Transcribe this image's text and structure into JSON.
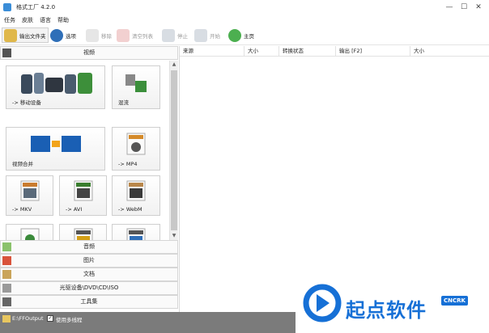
{
  "window": {
    "title": "格式工厂 4.2.0",
    "minimize": "—",
    "maximize": "☐",
    "close": "✕"
  },
  "menu": {
    "items": [
      "任务",
      "皮肤",
      "语言",
      "帮助"
    ]
  },
  "toolbar": {
    "output_folder": "输出文件夹",
    "options": "选项",
    "remove": "移除",
    "clear_list": "清空列表",
    "stop": "停止",
    "start": "开始",
    "home": "主页"
  },
  "left": {
    "video_header": "视频",
    "tiles": {
      "mobile": "-> 移动设备",
      "mux": "混流",
      "join": "视频合并",
      "mp4": "-> MP4",
      "mkv": "-> MKV",
      "avi": "-> AVI",
      "webm": "-> WebM"
    },
    "categories": [
      "音频",
      "图片",
      "文档",
      "光驱设备\\DVD\\CD\\ISO",
      "工具集"
    ]
  },
  "right": {
    "columns": [
      "来源",
      "大小",
      "转换状态",
      "输出 [F2]",
      "大小"
    ]
  },
  "status": {
    "path": "E:\\FFOutput",
    "checkbox_mark": "✓",
    "multithread": "使用多线程"
  },
  "watermark": {
    "text": "起点软件",
    "badge": "CNCRK"
  },
  "colors": {
    "accent": "#1670d6",
    "statusbar": "#7b7b7b"
  }
}
